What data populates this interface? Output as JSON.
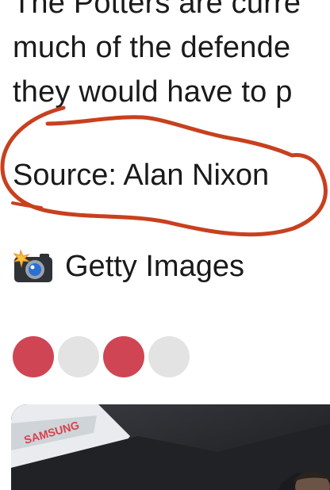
{
  "article": {
    "lines": [
      "The Potters are curre",
      "much of the defende",
      "they would have to p"
    ],
    "source_text": "Source: Alan Nixon"
  },
  "image_credit": {
    "icon": "camera-with-flash-icon",
    "text": "Getty Images"
  },
  "carousel": {
    "dots": [
      true,
      false,
      true,
      false
    ],
    "active_color": "#cf4554",
    "inactive_color": "#e3e3e3"
  },
  "photo": {
    "banner_text": "SAMSUNG"
  },
  "annotation": {
    "color": "#c8401f"
  }
}
